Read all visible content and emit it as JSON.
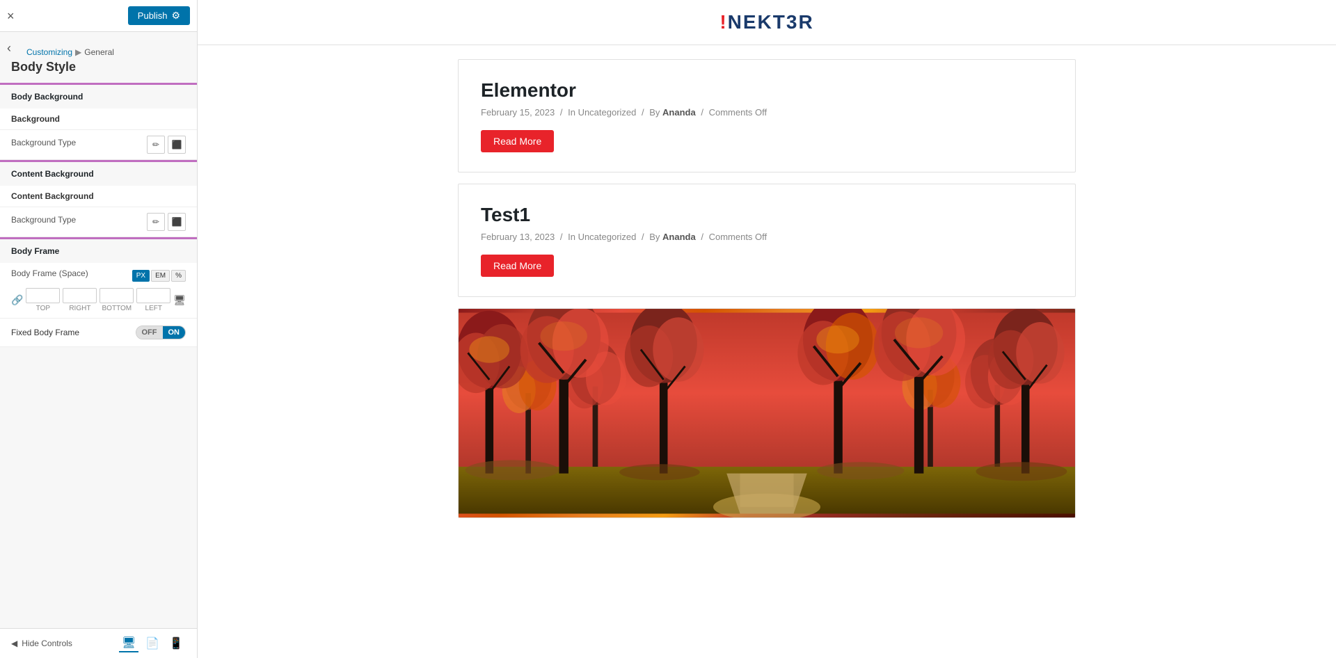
{
  "topbar": {
    "close_label": "×",
    "publish_label": "Publish",
    "gear_symbol": "⚙"
  },
  "breadcrumb": {
    "customizing": "Customizing",
    "separator": "▶",
    "section": "General"
  },
  "panel_title": "Body Style",
  "sections": {
    "body_background": {
      "label": "Body Background",
      "background_label": "Background",
      "background_type_label": "Background Type",
      "pencil_icon": "✏",
      "image_icon": "🖼"
    },
    "content_background": {
      "label": "Content Background",
      "background_label": "Content Background",
      "background_type_label": "Background Type",
      "pencil_icon": "✏",
      "image_icon": "🖼"
    },
    "body_frame": {
      "label": "Body Frame",
      "frame_space_label": "Body Frame (Space)",
      "units": [
        "PX",
        "EM",
        "%"
      ],
      "active_unit": "PX",
      "fields": {
        "top_label": "TOP",
        "right_label": "RIGHT",
        "bottom_label": "BOTTOM",
        "left_label": "LEFT",
        "top_value": "",
        "right_value": "",
        "bottom_value": "",
        "left_value": ""
      },
      "fixed_frame_label": "Fixed Body Frame",
      "toggle_off": "OFF",
      "toggle_on": "ON"
    }
  },
  "bottom_bar": {
    "hide_controls": "Hide Controls",
    "arrow_icon": "◀"
  },
  "preview": {
    "logo_text": "!NEKT3R",
    "posts": [
      {
        "title": "Elementor",
        "date": "February 15, 2023",
        "in_label": "In",
        "category": "Uncategorized",
        "by_label": "By",
        "author": "Ananda",
        "comments": "Comments Off",
        "read_more": "Read More"
      },
      {
        "title": "Test1",
        "date": "February 13, 2023",
        "in_label": "In",
        "category": "Uncategorized",
        "by_label": "By",
        "author": "Ananda",
        "comments": "Comments Off",
        "read_more": "Read More"
      }
    ]
  }
}
